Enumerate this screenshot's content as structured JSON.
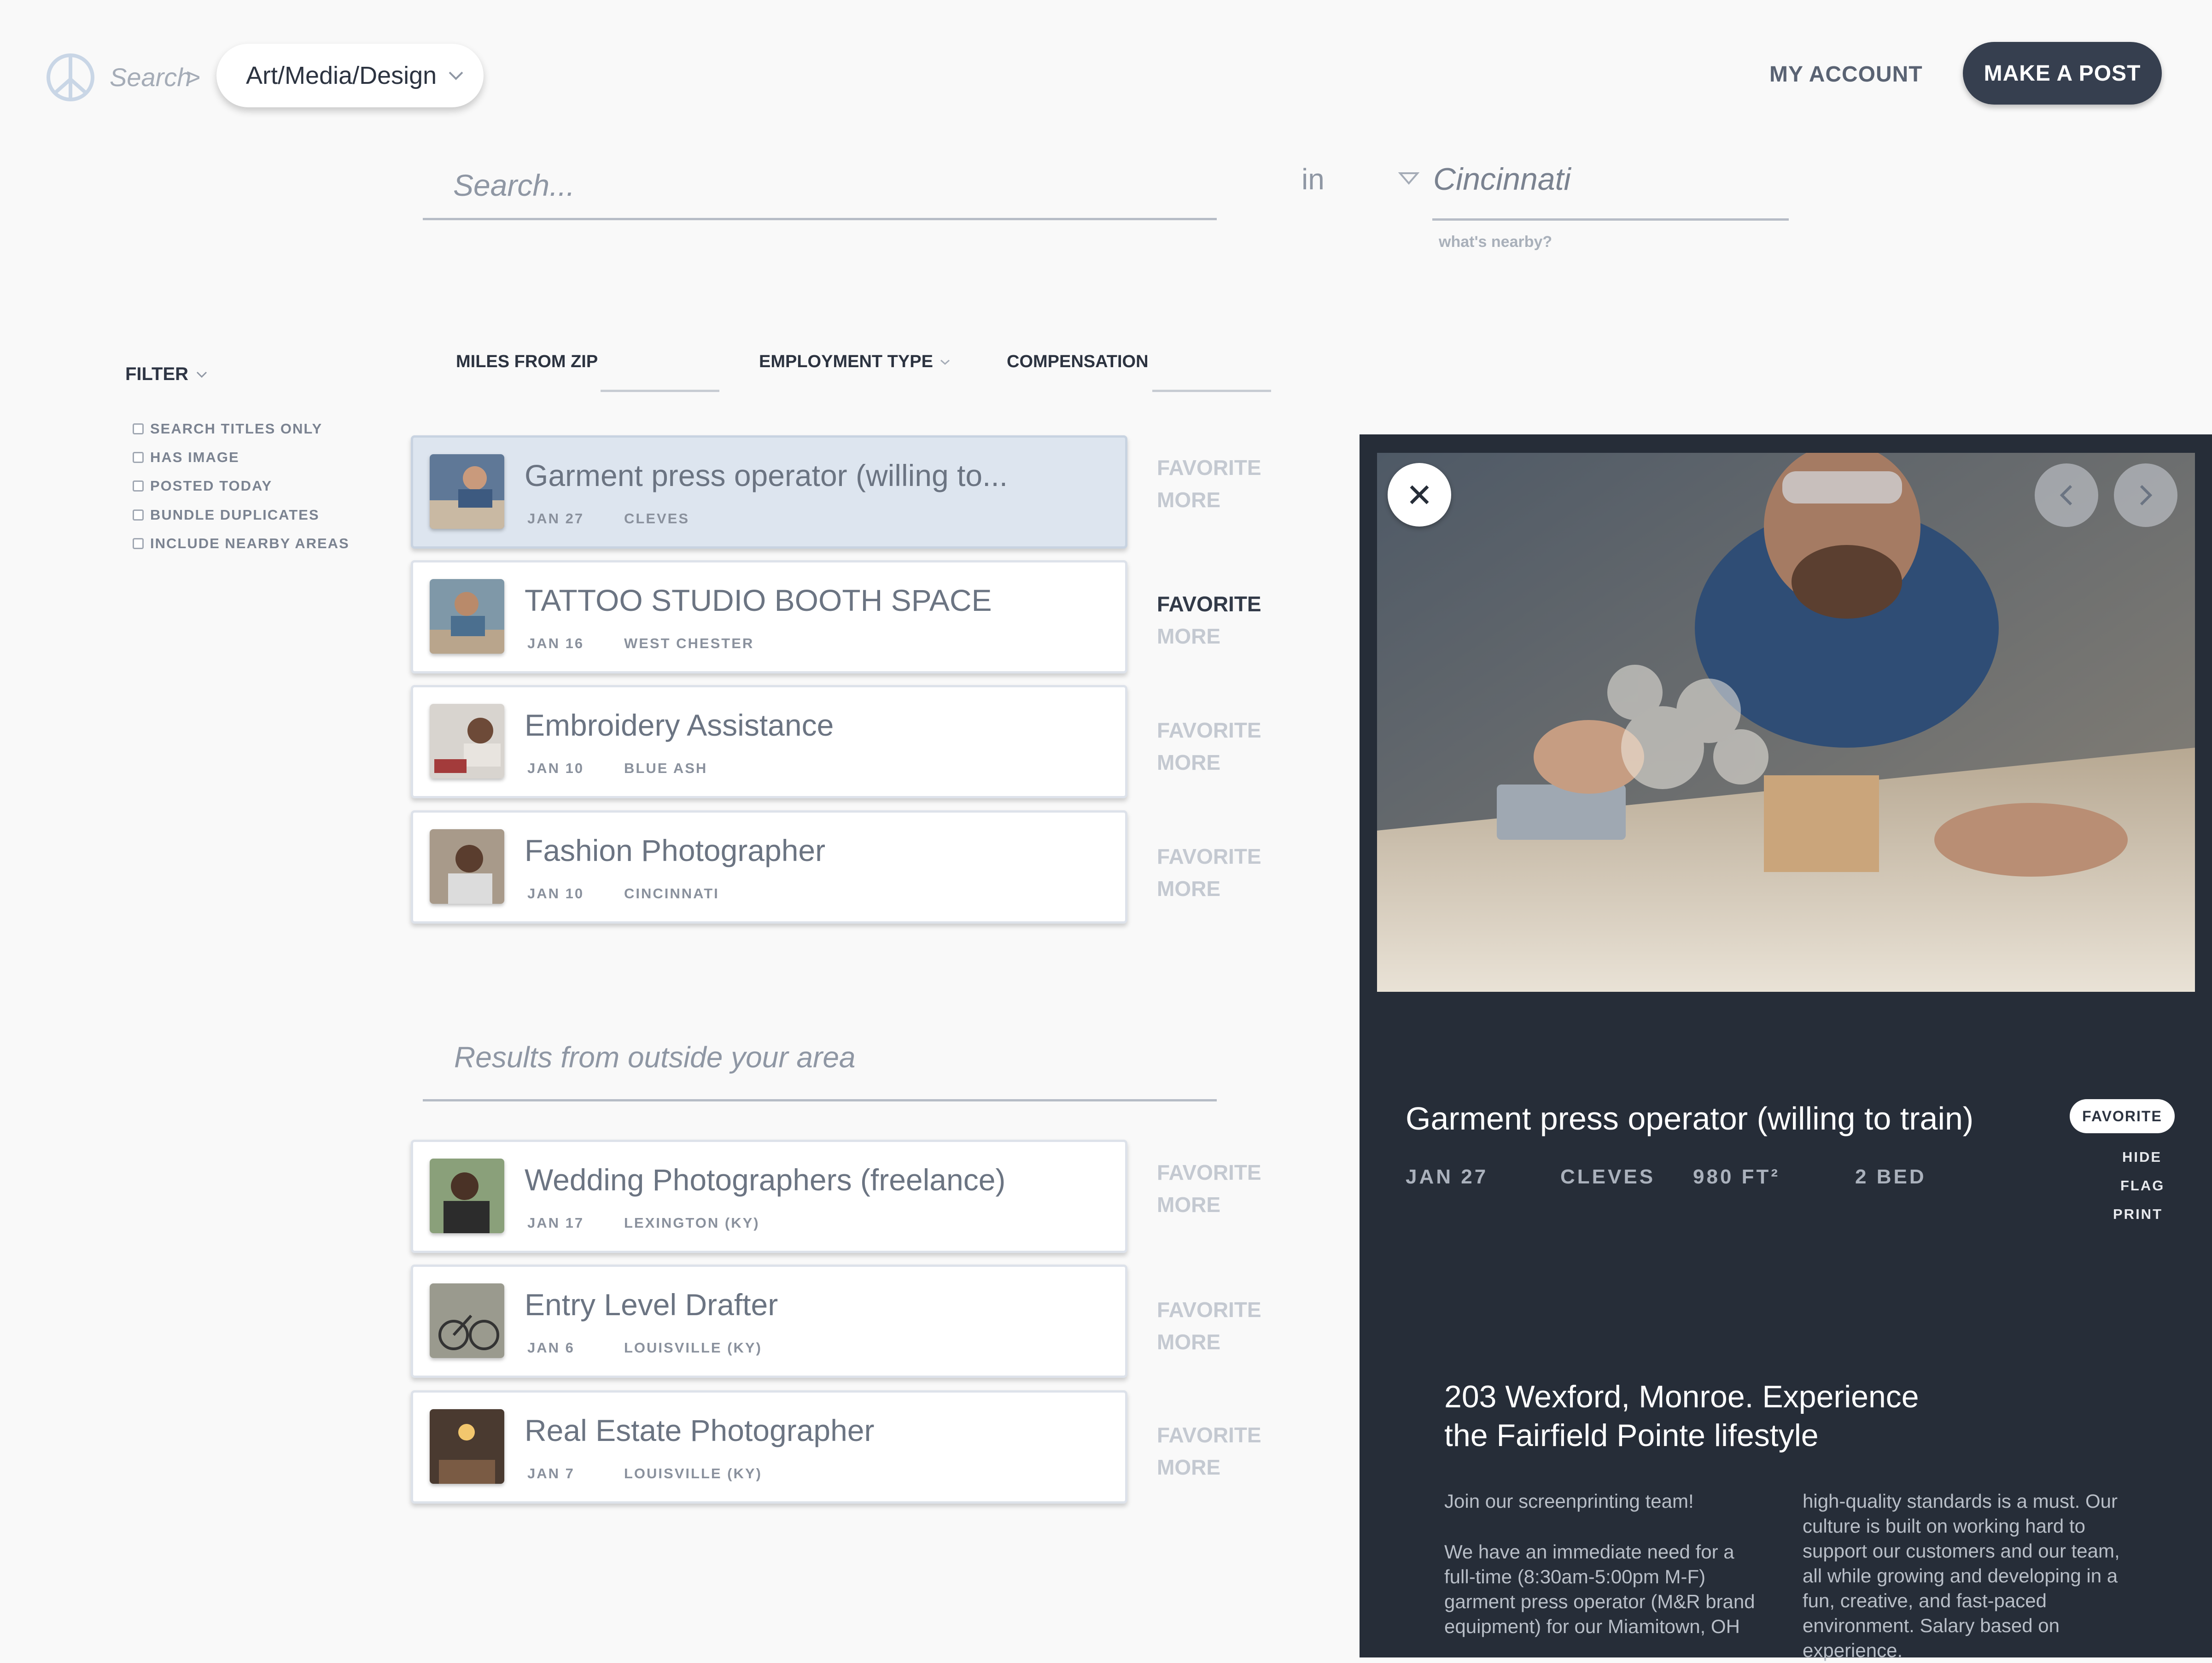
{
  "header": {
    "breadcrumb_root": "Search",
    "breadcrumb_sep": ">",
    "category": "Art/Media/Design",
    "my_account": "MY ACCOUNT",
    "make_post": "MAKE A POST"
  },
  "search": {
    "placeholder": "Search...",
    "in_label": "in",
    "location": "Cincinnati",
    "nearby": "what's nearby?"
  },
  "filters": {
    "toggle": "FILTER",
    "options": [
      "SEARCH TITLES ONLY",
      "HAS IMAGE",
      "POSTED TODAY",
      "BUNDLE DUPLICATES",
      "INCLUDE NEARBY AREAS"
    ],
    "facets": [
      "MILES FROM ZIP",
      "EMPLOYMENT TYPE",
      "COMPENSATION"
    ]
  },
  "actions": {
    "favorite": "FAVORITE",
    "more": "MORE"
  },
  "listings": [
    {
      "title": "Garment press operator (willing to...",
      "date": "JAN 27",
      "location": "CLEVES",
      "selected": true
    },
    {
      "title": "TATTOO STUDIO BOOTH SPACE",
      "date": "JAN 16",
      "location": "WEST CHESTER",
      "favorite_active": true
    },
    {
      "title": "Embroidery Assistance",
      "date": "JAN 10",
      "location": "BLUE ASH"
    },
    {
      "title": "Fashion Photographer",
      "date": "JAN 10",
      "location": "CINCINNATI"
    }
  ],
  "outside": {
    "heading": "Results from outside your area",
    "listings": [
      {
        "title": "Wedding Photographers (freelance)",
        "date": "JAN 17",
        "location": "LEXINGTON (KY)"
      },
      {
        "title": "Entry Level Drafter",
        "date": "JAN 6",
        "location": "LOUISVILLE (KY)"
      },
      {
        "title": "Real Estate Photographer",
        "date": "JAN 7",
        "location": "LOUISVILLE (KY)"
      }
    ]
  },
  "detail": {
    "title": "Garment press operator (willing to train)",
    "date": "JAN 27",
    "location": "CLEVES",
    "size": "980 FT²",
    "beds": "2 BED",
    "favorite": "FAVORITE",
    "hide": "HIDE",
    "flag": "FLAG",
    "print": "PRINT",
    "subtitle_line1": "203 Wexford, Monroe. Experience",
    "subtitle_line2": "the Fairfield Pointe lifestyle",
    "body_col1_p1": "Join our screenprinting team!",
    "body_col1_p2": "We have an immediate need for a full-time (8:30am-5:00pm M-F) garment press operator (M&R brand equipment) for our Miamitown, OH",
    "body_col2": "high-quality standards is a must. Our culture is built on working hard to support our customers and our team, all while growing and developing in a fun, creative, and fast-paced environment. Salary based on experience."
  },
  "icons": {
    "logo": "peace-logo-icon",
    "close": "close-icon",
    "prev": "chevron-left-icon",
    "next": "chevron-right-icon"
  },
  "colors": {
    "accent": "#363f4f",
    "panel": "#262d38",
    "selected_card": "#dde5ef"
  }
}
